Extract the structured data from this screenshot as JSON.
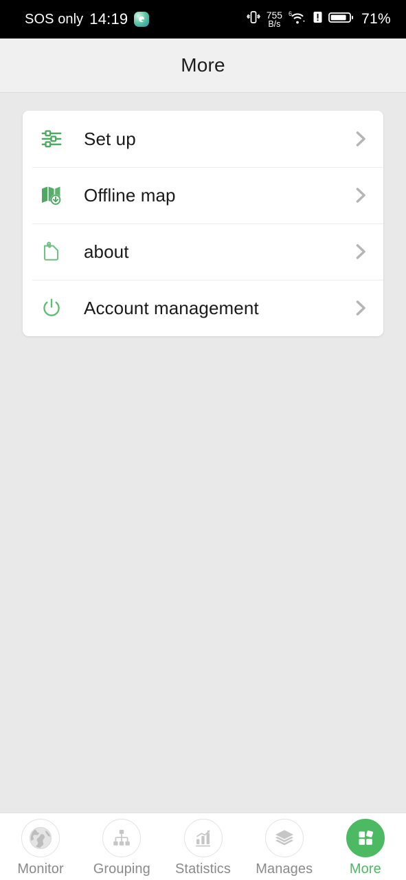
{
  "statusbar": {
    "carrier": "SOS only",
    "clock": "14:19",
    "app_badge_icon": "app-badge-icon",
    "vibrate_icon": "vibrate-icon",
    "network_speed_value": "755",
    "network_speed_unit": "B/s",
    "wifi_icon": "wifi-icon",
    "wifi_level_label": "6",
    "alert_icon": "alert-icon",
    "battery_icon": "battery-icon",
    "battery_text": "71%"
  },
  "header": {
    "title": "More"
  },
  "menu": {
    "items": [
      {
        "label": "Set up",
        "icon": "sliders-icon",
        "chevron": "chevron-right-icon"
      },
      {
        "label": "Offline map",
        "icon": "offline-map-download-icon",
        "chevron": "chevron-right-icon"
      },
      {
        "label": "about",
        "icon": "clipboard-icon",
        "chevron": "chevron-right-icon"
      },
      {
        "label": "Account management",
        "icon": "power-icon",
        "chevron": "chevron-right-icon"
      }
    ]
  },
  "tabbar": {
    "items": [
      {
        "label": "Monitor",
        "icon": "globe-icon",
        "active": false
      },
      {
        "label": "Grouping",
        "icon": "org-chart-icon",
        "active": false
      },
      {
        "label": "Statistics",
        "icon": "bar-chart-icon",
        "active": false
      },
      {
        "label": "Manages",
        "icon": "layers-icon",
        "active": false
      },
      {
        "label": "More",
        "icon": "grid-icon",
        "active": true
      }
    ]
  },
  "colors": {
    "accent_green": "#4cb963",
    "icon_green": "#5cb270",
    "page_background": "#e9e9e9",
    "card_background": "#ffffff",
    "header_background": "#f0f0f0",
    "chevron_gray": "#b5b5b5",
    "inactive_tab_gray": "#c4c4c4"
  }
}
